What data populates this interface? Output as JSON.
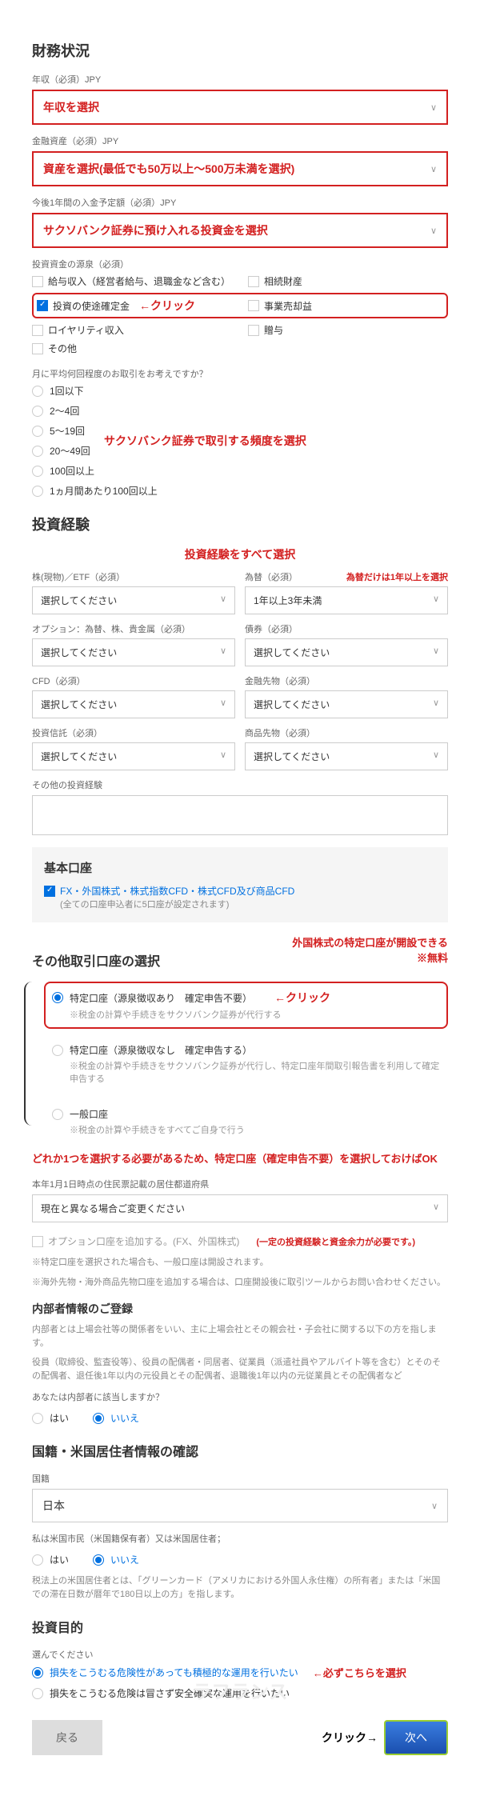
{
  "financial": {
    "title": "財務状況",
    "income_label": "年収（必須）JPY",
    "income_select": "年収を選択",
    "assets_label": "金融資産（必須）JPY",
    "assets_select": "資産を選択(最低でも50万以上～500万未満を選択)",
    "deposit_label": "今後1年間の入金予定額（必須）JPY",
    "deposit_select": "サクソバンク証券に預け入れる投資金を選択",
    "source_label": "投資資金の源泉（必須）",
    "sources": {
      "salary": "給与収入（経営者給与、退職金など含む）",
      "inheritance": "相続財産",
      "investment": "投資の使途確定金",
      "business": "事業売却益",
      "royalty": "ロイヤリティ収入",
      "gift": "贈与",
      "other": "その他"
    },
    "click_annot": "←クリック",
    "freq_label": "月に平均何回程度のお取引をお考えですか？",
    "freq_opts": [
      "1回以下",
      "2～4回",
      "5～19回",
      "20～49回",
      "100回以上",
      "1ヵ月間あたり100回以上"
    ],
    "freq_annot": "サクソバンク証券で取引する頻度を選択"
  },
  "experience": {
    "title": "投資経験",
    "annot": "投資経験をすべて選択",
    "fx_annot": "為替だけは1年以上を選択",
    "stock_label": "株(現物)／ETF（必須）",
    "fx_label": "為替（必須）",
    "option_label": "オプション：為替、株、貴金属（必須）",
    "bond_label": "債券（必須）",
    "cfd_label": "CFD（必須）",
    "futures_label": "金融先物（必須）",
    "trust_label": "投資信託（必須）",
    "commodity_label": "商品先物（必須）",
    "placeholder": "選択してください",
    "fx_value": "1年以上3年未満",
    "other_label": "その他の投資経験"
  },
  "basic_account": {
    "title": "基本口座",
    "option": "FX・外国株式・株式指数CFD・株式CFD及び商品CFD",
    "note": "(全ての口座申込者に5口座が設定されます)"
  },
  "other_account": {
    "title": "その他取引口座の選択",
    "annot_title": "外国株式の特定口座が開設できる",
    "annot_free": "※無料",
    "click": "←クリック",
    "opt1": "特定口座（源泉徴収あり　確定申告不要）",
    "opt1_note": "※税金の計算や手続きをサクソバンク証券が代行する",
    "opt2": "特定口座（源泉徴収なし　確定申告する）",
    "opt2_note": "※税金の計算や手続きをサクソバンク証券が代行し、特定口座年間取引報告書を利用して確定申告する",
    "opt3": "一般口座",
    "opt3_note": "※税金の計算や手続きをすべてご自身で行う",
    "red_note": "どれか1つを選択する必要があるため、特定口座（確定申告不要）を選択しておけばOK",
    "address_label": "本年1月1日時点の住民票記載の居住都道府県",
    "address_value": "現在と異なる場合ご変更ください",
    "option_cb": "オプション口座を追加する。(FX、外国株式)",
    "option_note": "(一定の投資経験と資金余力が必要です。)",
    "fine1": "※特定口座を選択された場合も、一般口座は開設されます。",
    "fine2": "※海外先物・海外商品先物口座を追加する場合は、口座開設後に取引ツールからお問い合わせください。"
  },
  "insider": {
    "title": "内部者情報のご登録",
    "desc": "内部者とは上場会社等の関係者をいい、主に上場会社とその親会社・子会社に関する以下の方を指します。",
    "desc2": "役員（取締役、監査役等）、役員の配偶者・同居者、従業員（派遣社員やアルバイト等を含む）とそのその配偶者、退任後1年以内の元役員とその配偶者、退職後1年以内の元従業員とその配偶者など",
    "question": "あなたは内部者に該当しますか？",
    "yes": "はい",
    "no": "いいえ"
  },
  "nationality": {
    "title": "国籍・米国居住者情報の確認",
    "label": "国籍",
    "value": "日本",
    "q1": "私は米国市民（米国籍保有者）又は米国居住者；",
    "yes": "はい",
    "no": "いいえ",
    "note": "税法上の米国居住者とは、「グリーンカード（アメリカにおける外国人永住権）の所有者」または「米国での滞在日数が暦年で180日以上の方」を指します。"
  },
  "purpose": {
    "title": "投資目的",
    "label": "選んでください",
    "opt1": "損失をこうむる危険性があっても積極的な運用を行いたい",
    "opt2": "損失をこうむる危険は冒さず安全確実な運用を行いたい",
    "annot": "←必ずこちらを選択"
  },
  "nav": {
    "back": "戻る",
    "click": "クリック→",
    "next": "次へ"
  },
  "watermark": "ラフランス"
}
